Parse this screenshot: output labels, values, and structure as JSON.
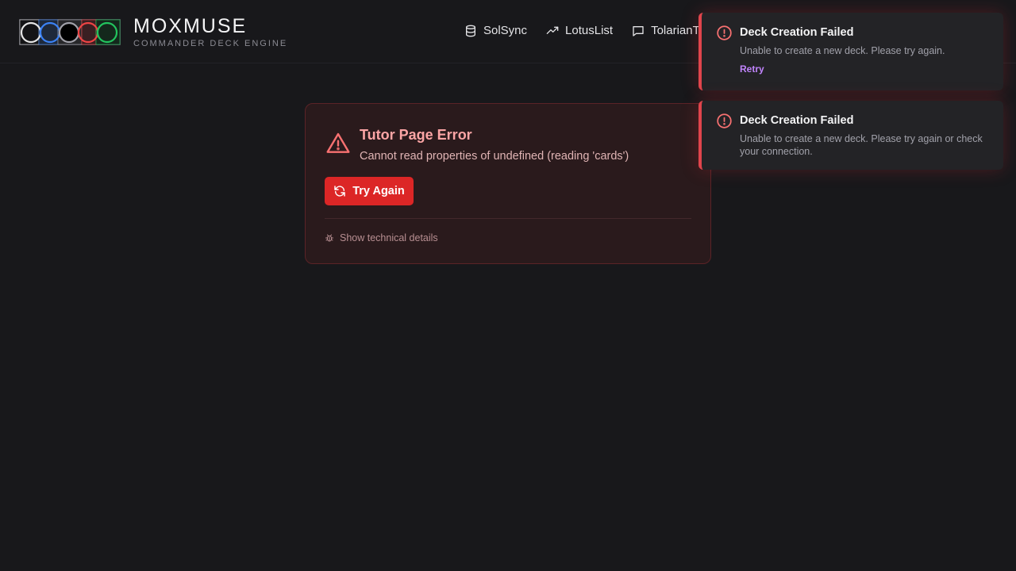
{
  "brand": {
    "title": "MOXMUSE",
    "subtitle": "COMMANDER DECK ENGINE",
    "mana_colors": [
      "#e5e5e5",
      "#3b82f6",
      "#a1a1aa",
      "#ef4444",
      "#22c55e"
    ]
  },
  "nav": {
    "items": [
      {
        "label": "SolSync",
        "icon": "database-icon"
      },
      {
        "label": "LotusList",
        "icon": "trending-up-icon"
      },
      {
        "label": "TolarianTutor",
        "icon": "message-icon"
      }
    ]
  },
  "error": {
    "title": "Tutor Page Error",
    "message": "Cannot read properties of undefined (reading 'cards')",
    "retry_label": "Try Again",
    "details_label": "Show technical details"
  },
  "toasts": [
    {
      "title": "Deck Creation Failed",
      "message": "Unable to create a new deck. Please try again.",
      "action": "Retry"
    },
    {
      "title": "Deck Creation Failed",
      "message": "Unable to create a new deck. Please try again or check your connection."
    }
  ],
  "colors": {
    "background": "#18181b",
    "error_accent": "#dc2626",
    "toast_border": "#e0454c",
    "link": "#c084fc"
  }
}
